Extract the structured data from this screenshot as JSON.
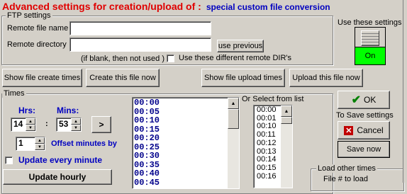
{
  "header": {
    "title_prefix": "Advanced settings for creation/upload of :",
    "title_suffix": "special custom file conversion"
  },
  "ftp": {
    "group_label": "FTP settings",
    "remote_file_label": "Remote file name",
    "remote_file_value": "",
    "remote_dir_label": "Remote directory",
    "remote_dir_value": "",
    "use_previous_label": "use previous",
    "blank_note": "(if blank, then not used )",
    "diff_dirs_label": "Use these different remote DIR's"
  },
  "use_settings": {
    "label": "Use these settings",
    "toggle_state": "On",
    "on_color": "#00ff00"
  },
  "action_buttons": {
    "show_create": "Show file create times",
    "create_now": "Create this file now",
    "show_upload": "Show file upload times",
    "upload_now": "Upload this file now"
  },
  "times": {
    "group_label": "Times",
    "hrs_label": "Hrs:",
    "mins_label": "Mins:",
    "hrs_value": "14",
    "mins_value": "53",
    "colon": ":",
    "go_glyph": ">",
    "offset_value": "1",
    "offset_label": "Offset minutes by",
    "update_every_minute_label": "Update every minute",
    "update_hourly_label": "Update hourly",
    "time_list": [
      "00:00",
      "00:05",
      "00:10",
      "00:15",
      "00:20",
      "00:25",
      "00:30",
      "00:35",
      "00:40",
      "00:45"
    ],
    "select_label": "Or Select from list",
    "select_list": [
      "00:00",
      "00:01",
      "00:10",
      "00:11",
      "00:12",
      "00:13",
      "00:14",
      "00:15",
      "00:16"
    ]
  },
  "right_panel": {
    "ok_label": "OK",
    "to_save_label": "To Save settings",
    "cancel_label": "Cancel",
    "save_now_label": "Save now",
    "load_group_label": "Load other times",
    "file_to_load_label": "File # to load"
  },
  "colors": {
    "ok_check": "#008000",
    "cancel_x": "#c00000",
    "title_red": "#e00000",
    "title_blue": "#0000c0"
  }
}
